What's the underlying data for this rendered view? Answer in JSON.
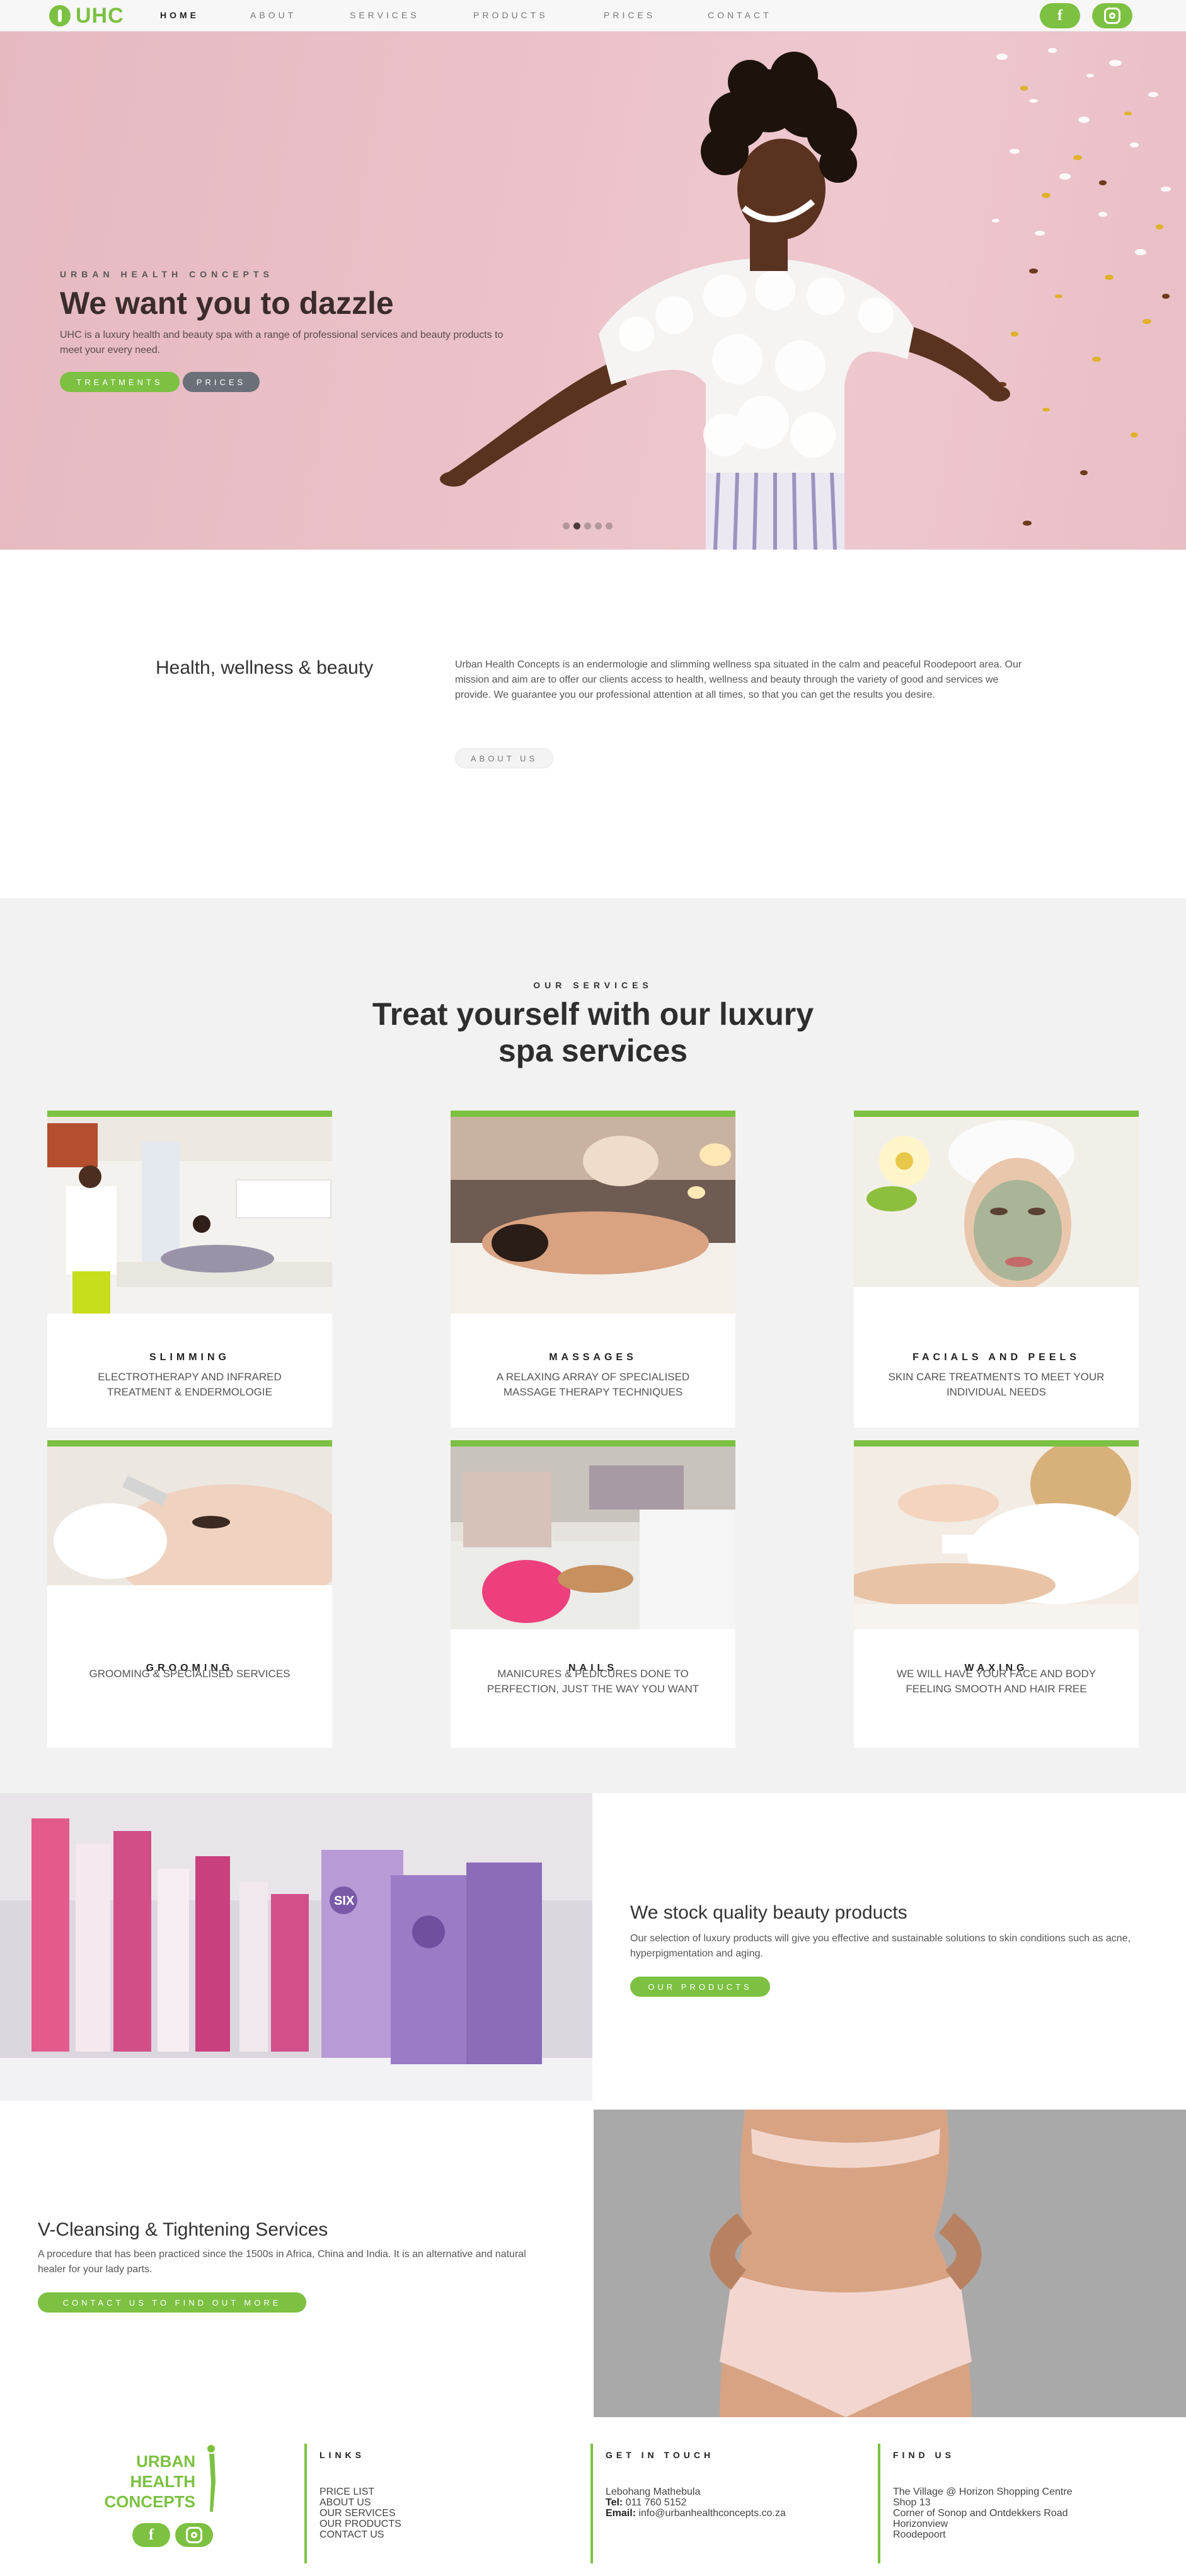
{
  "brand": {
    "logo_text": "UHC",
    "accent": "#7cc142"
  },
  "nav": {
    "items": [
      {
        "label": "HOME",
        "active": true
      },
      {
        "label": "ABOUT"
      },
      {
        "label": "SERVICES"
      },
      {
        "label": "PRODUCTS"
      },
      {
        "label": "PRICES"
      },
      {
        "label": "CONTACT"
      }
    ],
    "social": [
      "facebook-icon",
      "instagram-icon"
    ]
  },
  "hero": {
    "kicker": "URBAN HEALTH CONCEPTS",
    "title": "We want you to dazzle",
    "text": "UHC is a luxury health and beauty spa with a range of professional services and beauty products to meet your every need.",
    "btn_treatments": "TREATMENTS",
    "btn_prices": "PRICES",
    "slide_count": 5,
    "active_slide": 2
  },
  "intro": {
    "title": "Health, wellness & beauty",
    "text": "Urban Health Concepts is an endermologie and slimming wellness spa situated in the calm and peaceful Roodepoort area. Our mission and aim are to offer our clients access to health, wellness and beauty through the variety of good and services we provide. We guarantee you our professional attention at all times, so that you can get the results you desire.",
    "button": "ABOUT US"
  },
  "services": {
    "kicker": "OUR SERVICES",
    "title_line1": "Treat yourself with our luxury",
    "title_line2": "spa services",
    "cards": [
      {
        "title": "SLIMMING",
        "desc": "ELECTROTHERAPY AND INFRARED TREATMENT & ENDERMOLOGIE"
      },
      {
        "title": "MASSAGES",
        "desc": "A RELAXING ARRAY OF SPECIALISED MASSAGE THERAPY TECHNIQUES"
      },
      {
        "title": "FACIALS AND PEELS",
        "desc": "SKIN CARE TREATMENTS TO MEET YOUR INDIVIDUAL NEEDS"
      },
      {
        "title": "GROOMING",
        "desc": "GROOMING & SPECIALISED SERVICES"
      },
      {
        "title": "NAILS",
        "desc": "MANICURES & PEDICURES DONE TO PERFECTION, JUST THE WAY YOU WANT"
      },
      {
        "title": "WAXING",
        "desc": "WE WILL HAVE YOUR FACE AND BODY FEELING SMOOTH AND HAIR FREE"
      }
    ]
  },
  "products": {
    "title": "We stock quality beauty products",
    "text": "Our selection of luxury products will give you effective and sustainable solutions to skin conditions such as acne, hyperpigmentation and aging.",
    "button": "OUR PRODUCTS",
    "box_label": "SIX"
  },
  "vcleansing": {
    "title": "V-Cleansing & Tightening Services",
    "text": "A procedure that has been practiced since the 1500s in Africa, China and India. It is an alternative and natural healer for your lady parts.",
    "button": "CONTACT US TO FIND OUT MORE"
  },
  "footer": {
    "logo_line1": "URBAN",
    "logo_line2": "HEALTH",
    "logo_line3": "CONCEPTS",
    "links_heading": "LINKS",
    "links": [
      "PRICE LIST",
      "ABOUT US",
      "OUR SERVICES",
      "OUR PRODUCTS",
      "CONTACT US"
    ],
    "contact_heading": "GET IN TOUCH",
    "contact_name": "Lebohang Mathebula",
    "tel_label": "Tel:",
    "tel_value": "011 760 5152",
    "email_label": "Email:",
    "email_value": "info@urbanhealthconcepts.co.za",
    "find_heading": "FIND US",
    "address": [
      "The Village @ Horizon Shopping Centre",
      "Shop 13",
      "Corner of Sonop and Ontdekkers Road",
      "Horizonview",
      "Roodepoort"
    ]
  }
}
